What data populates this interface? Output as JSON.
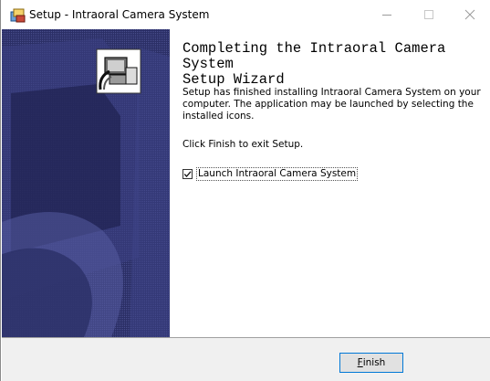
{
  "window": {
    "title": "Setup - Intraoral Camera System",
    "controls": {
      "minimize": "minimize-icon",
      "maximize": "maximize-icon",
      "close": "close-icon"
    }
  },
  "content": {
    "heading": "Completing the Intraoral Camera System\nSetup Wizard",
    "paragraph1": "Setup has finished installing Intraoral Camera System on your computer. The application may be launched by selecting the installed icons.",
    "paragraph2": "Click Finish to exit Setup.",
    "launch_checkbox": {
      "label": "Launch Intraoral Camera System",
      "checked": true
    }
  },
  "footer": {
    "finish_button": {
      "accel": "F",
      "rest": "inish"
    }
  },
  "colors": {
    "side_panel": "#2b2f66",
    "button_border": "#0078d7",
    "footer_bg": "#f0f0f0"
  }
}
